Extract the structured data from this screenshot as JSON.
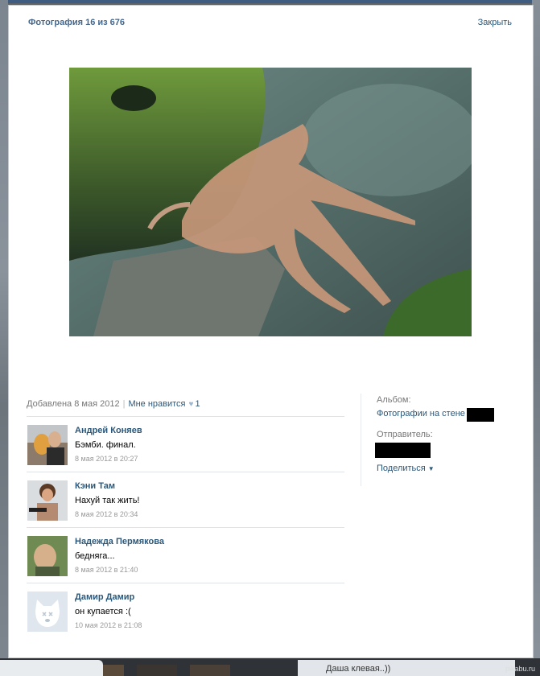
{
  "viewer": {
    "title": "Фотография 16 из 676",
    "close_label": "Закрыть"
  },
  "photo_info": {
    "added": "Добавлена 8 мая 2012",
    "like_label": "Мне нравится",
    "likes_count": "1"
  },
  "comments": [
    {
      "author": "Андрей Коняев",
      "text": "Бэмби. финал.",
      "date": "8 мая 2012 в 20:27"
    },
    {
      "author": "Кэни Там",
      "text": "Нахуй так жить!",
      "date": "8 мая 2012 в 20:34"
    },
    {
      "author": "Надежда Пермякова",
      "text": "бедняга...",
      "date": "8 мая 2012 в 21:40"
    },
    {
      "author": "Дамир Дамир",
      "text": "он купается :(",
      "date": "10 мая 2012 в 21:08"
    }
  ],
  "sidebar": {
    "album_label": "Альбом:",
    "album_link": "Фотографии на стене",
    "sender_label": "Отправитель:",
    "share_label": "Поделиться"
  },
  "background": {
    "chat_snippet": "Даша клевая..))",
    "watermark": "pikabu.ru"
  },
  "colors": {
    "link": "#2b587a",
    "title": "#45688e",
    "muted": "#777777"
  }
}
